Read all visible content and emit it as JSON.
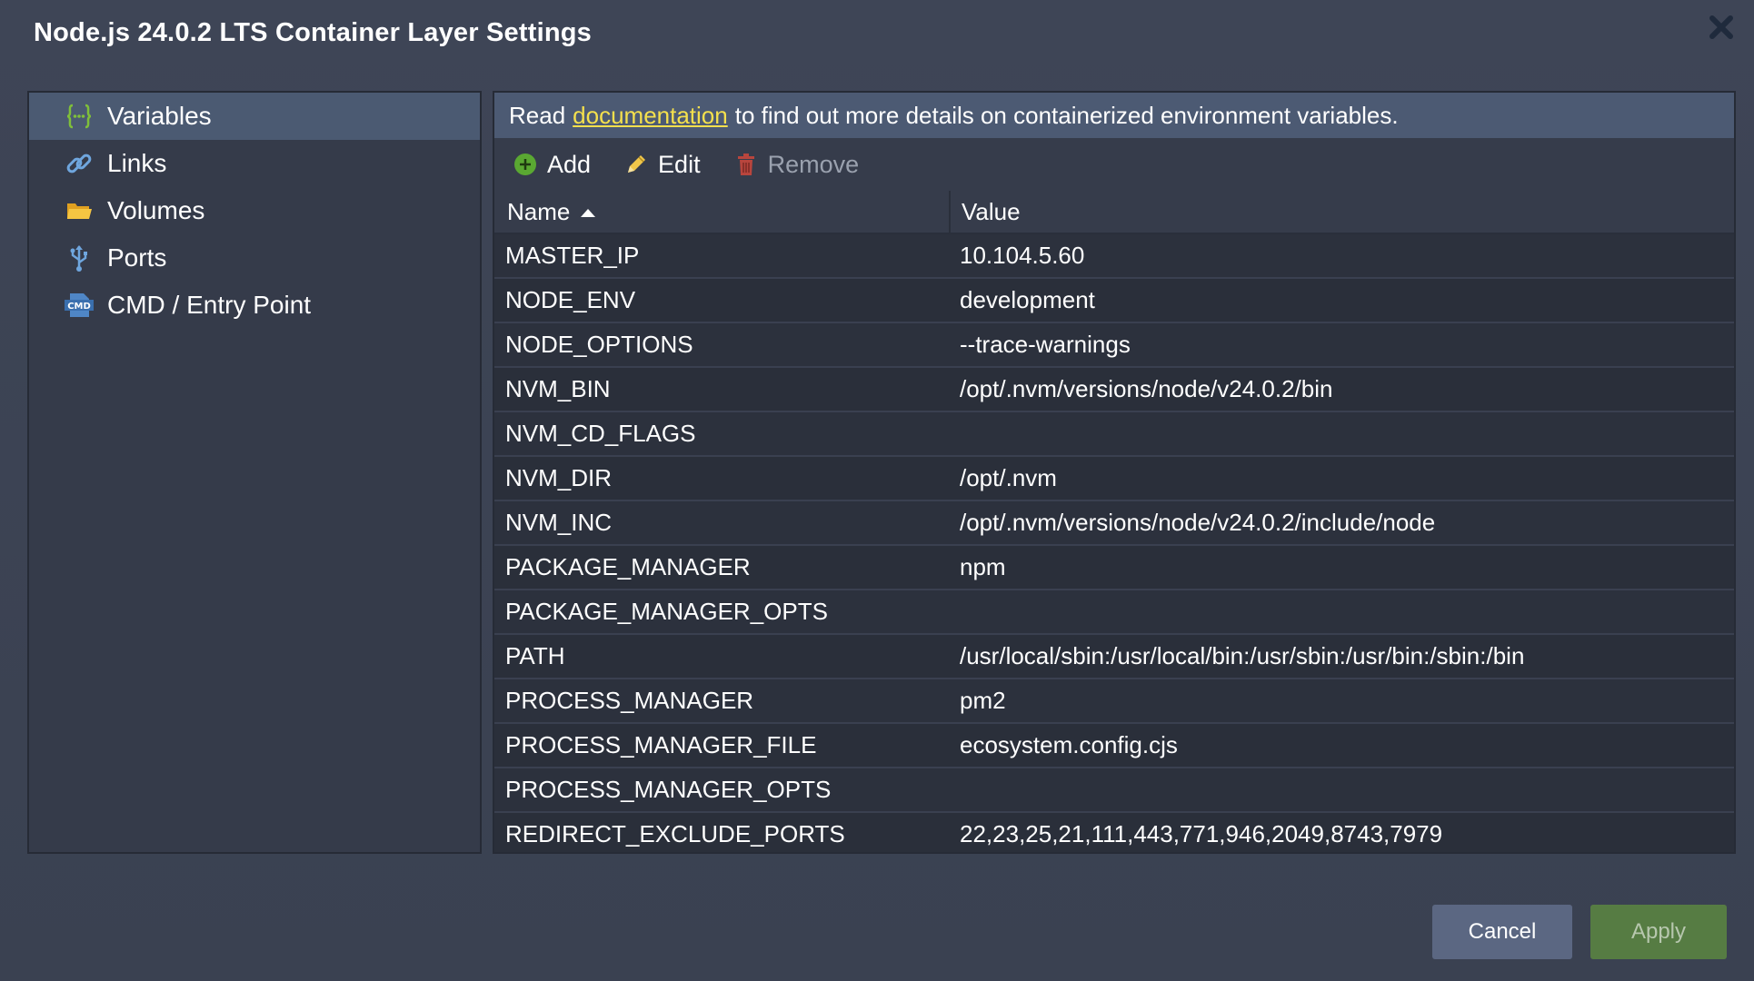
{
  "dialog": {
    "title": "Node.js 24.0.2 LTS Container Layer Settings"
  },
  "sidebar": {
    "items": [
      {
        "label": "Variables",
        "icon": "variables-icon",
        "active": true
      },
      {
        "label": "Links",
        "icon": "link-icon",
        "active": false
      },
      {
        "label": "Volumes",
        "icon": "folder-icon",
        "active": false
      },
      {
        "label": "Ports",
        "icon": "usb-port-icon",
        "active": false
      },
      {
        "label": "CMD / Entry Point",
        "icon": "cmd-icon",
        "active": false
      }
    ]
  },
  "info": {
    "prefix": "Read",
    "link": "documentation",
    "suffix": "to find out more details on containerized environment variables."
  },
  "toolbar": {
    "add_label": "Add",
    "edit_label": "Edit",
    "remove_label": "Remove"
  },
  "table": {
    "columns": [
      "Name",
      "Value"
    ],
    "rows": [
      {
        "name": "MASTER_IP",
        "value": "10.104.5.60"
      },
      {
        "name": "NODE_ENV",
        "value": "development"
      },
      {
        "name": "NODE_OPTIONS",
        "value": "--trace-warnings"
      },
      {
        "name": "NVM_BIN",
        "value": "/opt/.nvm/versions/node/v24.0.2/bin"
      },
      {
        "name": "NVM_CD_FLAGS",
        "value": ""
      },
      {
        "name": "NVM_DIR",
        "value": "/opt/.nvm"
      },
      {
        "name": "NVM_INC",
        "value": "/opt/.nvm/versions/node/v24.0.2/include/node"
      },
      {
        "name": "PACKAGE_MANAGER",
        "value": "npm"
      },
      {
        "name": "PACKAGE_MANAGER_OPTS",
        "value": ""
      },
      {
        "name": "PATH",
        "value": "/usr/local/sbin:/usr/local/bin:/usr/sbin:/usr/bin:/sbin:/bin"
      },
      {
        "name": "PROCESS_MANAGER",
        "value": "pm2"
      },
      {
        "name": "PROCESS_MANAGER_FILE",
        "value": "ecosystem.config.cjs"
      },
      {
        "name": "PROCESS_MANAGER_OPTS",
        "value": ""
      },
      {
        "name": "REDIRECT_EXCLUDE_PORTS",
        "value": "22,23,25,21,111,443,771,946,2049,8743,7979"
      }
    ]
  },
  "footer": {
    "cancel_label": "Cancel",
    "apply_label": "Apply"
  },
  "colors": {
    "accent_link": "#f4e04d",
    "active_item": "#4b5a72",
    "apply_button": "#567c43",
    "cancel_button": "#5b6782"
  }
}
